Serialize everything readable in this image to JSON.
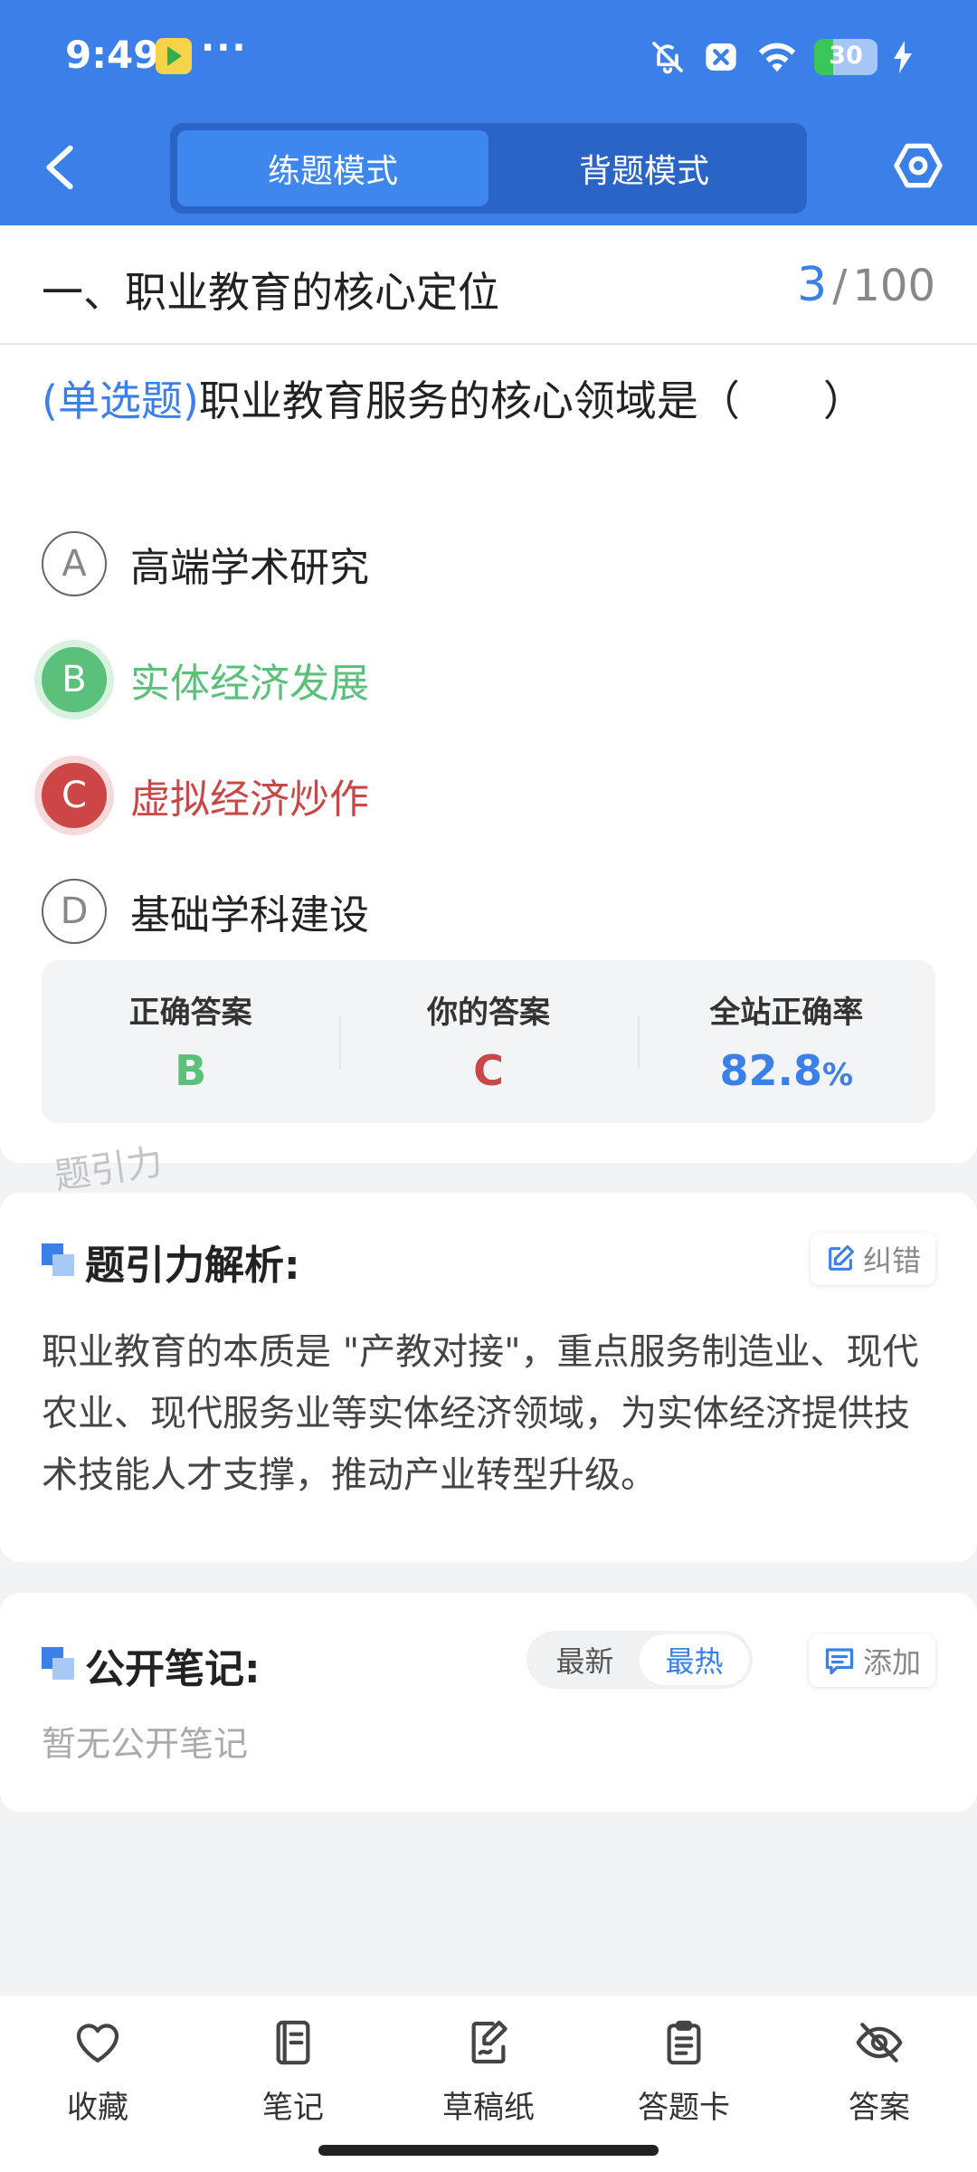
{
  "status_bar": {
    "time": "9:49",
    "dots": "···",
    "battery": "30"
  },
  "header": {
    "tabs": [
      "练题模式",
      "背题模式"
    ],
    "active_tab": 0,
    "accent_color": "#3a80e8"
  },
  "question": {
    "section_title": "一、职业教育的核心定位",
    "progress_current": "3",
    "progress_separator": "/",
    "progress_total": "100",
    "type": "(单选题)",
    "text": "职业教育服务的核心领域是（　　）",
    "options": [
      {
        "letter": "A",
        "text": "高端学术研究",
        "state": "normal"
      },
      {
        "letter": "B",
        "text": "实体经济发展",
        "state": "correct"
      },
      {
        "letter": "C",
        "text": "虚拟经济炒作",
        "state": "wrong"
      },
      {
        "letter": "D",
        "text": "基础学科建设",
        "state": "normal"
      }
    ]
  },
  "answer_summary": {
    "correct_label": "正确答案",
    "correct_value": "B",
    "yours_label": "你的答案",
    "yours_value": "C",
    "rate_label": "全站正确率",
    "rate_value": "82.8",
    "rate_unit": "%"
  },
  "watermark": "题引力",
  "analysis": {
    "title": "题引力解析:",
    "report_label": "纠错",
    "text": "职业教育的本质是 \"产教对接\"，重点服务制造业、现代农业、现代服务业等实体经济领域，为实体经济提供技术技能人才支撑，推动产业转型升级。"
  },
  "notes": {
    "title": "公开笔记:",
    "sort_options": [
      "最新",
      "最热"
    ],
    "active_sort": 1,
    "add_label": "添加",
    "empty_text": "暂无公开笔记"
  },
  "bottom_bar": {
    "items": [
      {
        "label": "收藏",
        "icon": "heart-icon"
      },
      {
        "label": "笔记",
        "icon": "notebook-icon"
      },
      {
        "label": "草稿纸",
        "icon": "draft-paper-icon"
      },
      {
        "label": "答题卡",
        "icon": "answer-card-icon"
      },
      {
        "label": "答案",
        "icon": "eye-off-icon"
      }
    ]
  }
}
